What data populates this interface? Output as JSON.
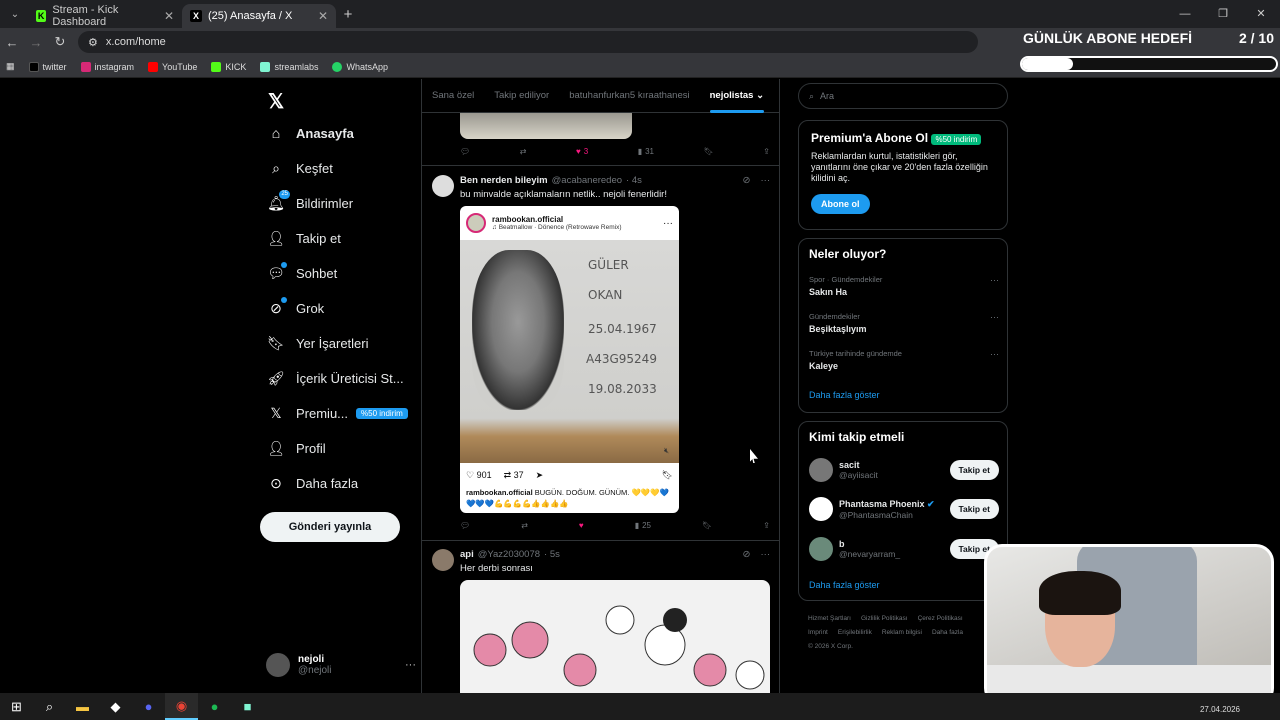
{
  "browser": {
    "tabs": [
      {
        "title": "Stream - Kick Dashboard",
        "icon": "kick-icon",
        "active": false
      },
      {
        "title": "(25) Anasayfa / X",
        "icon": "x-icon",
        "active": true
      }
    ],
    "url": "x.com/home",
    "bookmarks": [
      {
        "label": "twitter",
        "color": "#000000"
      },
      {
        "label": "instagram",
        "color": "#d62976"
      },
      {
        "label": "YouTube",
        "color": "#ff0000"
      },
      {
        "label": "KICK",
        "color": "#53fc18"
      },
      {
        "label": "streamlabs",
        "color": "#80f5d2"
      },
      {
        "label": "WhatsApp",
        "color": "#25d366"
      }
    ]
  },
  "overlay": {
    "goal_title": "GÜNLÜK ABONE HEDEFİ",
    "goal_count": "2 / 10",
    "goal_progress": 0.2
  },
  "nav": {
    "items": [
      {
        "label": "Anasayfa",
        "icon": "home-icon",
        "bold": true
      },
      {
        "label": "Keşfet",
        "icon": "search-icon"
      },
      {
        "label": "Bildirimler",
        "icon": "bell-icon",
        "badge": "25"
      },
      {
        "label": "Takip et",
        "icon": "add-person-icon"
      },
      {
        "label": "Sohbet",
        "icon": "chat-icon",
        "dot": true
      },
      {
        "label": "Grok",
        "icon": "grok-icon",
        "dot": true
      },
      {
        "label": "Yer İşaretleri",
        "icon": "bookmark-icon"
      },
      {
        "label": "İçerik Üreticisi St...",
        "icon": "rocket-icon"
      },
      {
        "label": "Premiu...",
        "icon": "x-icon",
        "pill": "%50 indirim"
      },
      {
        "label": "Profil",
        "icon": "person-icon"
      },
      {
        "label": "Daha fazla",
        "icon": "more-circle-icon"
      }
    ],
    "post_button": "Gönderi yayınla",
    "account": {
      "name": "nejoli",
      "handle": "@nejoli"
    }
  },
  "feed": {
    "tabs": [
      "Sana özel",
      "Takip ediliyor",
      "batuhanfurkan5 kıraathanesi",
      "nejolistas"
    ],
    "selected_tab": "nejolistas",
    "prev_actions": {
      "likes": "3",
      "views": "31"
    },
    "tweet1": {
      "name": "Ben nerden bileyim",
      "handle": "@acabaneredeo",
      "time": "· 4s",
      "text": "bu minvalde açıklamaların netlik.. nejoli fenerlidir!",
      "insta": {
        "user": "rambookan.official",
        "song": "Beatmallow · Dönence (Retrowave Remix)",
        "likes": "901",
        "reposts": "37",
        "caption_user": "rambookan.official",
        "caption": "BUGÜN. DOĞUM. GÜNÜM. 💛💛💛💙💙💙💙💪💪💪💪👍👍👍👍",
        "card_surname": "GÜLER",
        "card_name": "OKAN",
        "card_birth": "25.04.1967",
        "card_serial": "A43G95249",
        "card_expiry": "19.08.2033"
      },
      "views": "25"
    },
    "tweet2": {
      "name": "api",
      "handle": "@Yaz2030078",
      "time": "· 5s",
      "text": "Her derbi sonrası"
    }
  },
  "sidebar": {
    "search_placeholder": "Ara",
    "premium": {
      "title": "Premium'a Abone Ol",
      "discount": "%50 indirim",
      "desc": "Reklamlardan kurtul, istatistikleri gör, yanıtlarını öne çıkar ve 20'den fazla özelliğin kilidini aç.",
      "button": "Abone ol"
    },
    "trends": {
      "title": "Neler oluyor?",
      "items": [
        {
          "category": "Spor · Gündemdekiler",
          "topic": "Sakın Ha"
        },
        {
          "category": "Gündemdekiler",
          "topic": "Beşiktaşlıyım"
        },
        {
          "category": "Türkiye tarihinde gündemde",
          "topic": "Kaleye"
        }
      ],
      "show_more": "Daha fazla göster"
    },
    "who": {
      "title": "Kimi takip etmeli",
      "items": [
        {
          "name": "sacit",
          "handle": "@ayiisacit",
          "button": "Takip et"
        },
        {
          "name": "Phantasma Phoenix",
          "handle": "@PhantasmaChain",
          "button": "Takip et",
          "verified": true
        },
        {
          "name": "b",
          "handle": "@nevaryarram_",
          "button": "Takip et"
        }
      ],
      "show_more": "Daha fazla göster"
    },
    "footer": [
      "Hizmet Şartları",
      "Gizlilik Politikası",
      "Çerez Politikası",
      "Imprint",
      "Erişilebilirlik",
      "Reklam bilgisi",
      "Daha fazla",
      "© 2026 X Corp."
    ]
  },
  "taskbar": {
    "date": "27.04.2026"
  }
}
